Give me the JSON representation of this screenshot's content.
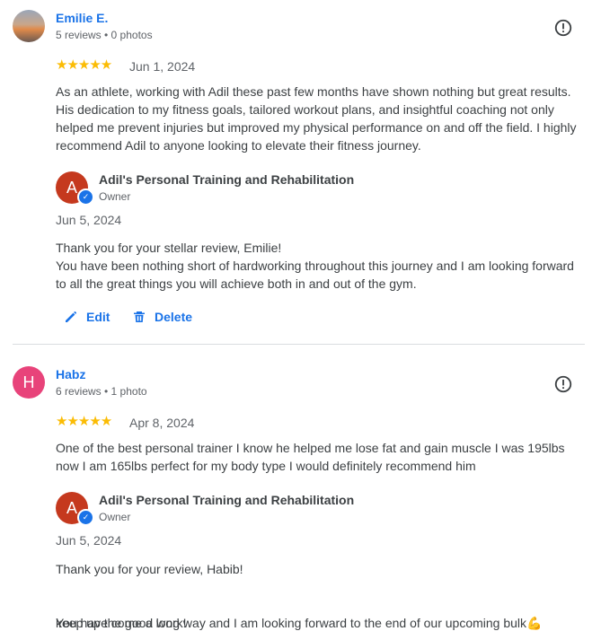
{
  "reviews": [
    {
      "author": "Emilie E.",
      "meta": "5 reviews • 0 photos",
      "stars": "★★★★★",
      "date": "Jun 1, 2024",
      "text": "As an athlete, working with Adil these past few months have shown nothing but great results. His dedication to my fitness goals, tailored workout plans, and insightful coaching not only helped me prevent injuries but improved my physical performance on and off the field. I highly recommend Adil to anyone looking to elevate their fitness journey.",
      "reply": {
        "owner_initial": "A",
        "owner_name": "Adil's Personal Training and Rehabilitation",
        "owner_role": "Owner",
        "date": "Jun 5, 2024",
        "text": "Thank you for your stellar review, Emilie!\nYou have been nothing short of hardworking throughout this journey and I am looking forward to all the great things you will achieve both in and out of the gym."
      },
      "actions": {
        "edit": "Edit",
        "delete": "Delete"
      }
    },
    {
      "author": "Habz",
      "avatar_initial": "H",
      "avatar_color": "#e8437a",
      "meta": "6 reviews • 1 photo",
      "stars": "★★★★★",
      "date": "Apr 8, 2024",
      "text": "One of the best personal trainer I know he helped me lose fat and gain muscle I was 195lbs now I am 165lbs perfect for my body type I would definitely recommend him",
      "reply": {
        "owner_initial": "A",
        "owner_name": "Adil's Personal Training and Rehabilitation",
        "owner_role": "Owner",
        "date": "Jun 5, 2024",
        "text_line1": "Thank you for your review, Habib!",
        "text_line2": "You have come a long way and I am looking forward to the end of our upcoming bulk",
        "emoji": "💪",
        "text_line3": "keep up the good work!"
      }
    }
  ],
  "colors": {
    "link": "#1a73e8",
    "star": "#fbbc04",
    "owner_avatar": "#c5391e"
  },
  "icons": {
    "flag": "report-icon",
    "edit": "pencil-icon",
    "delete": "trash-icon",
    "verified": "check-badge-icon"
  }
}
